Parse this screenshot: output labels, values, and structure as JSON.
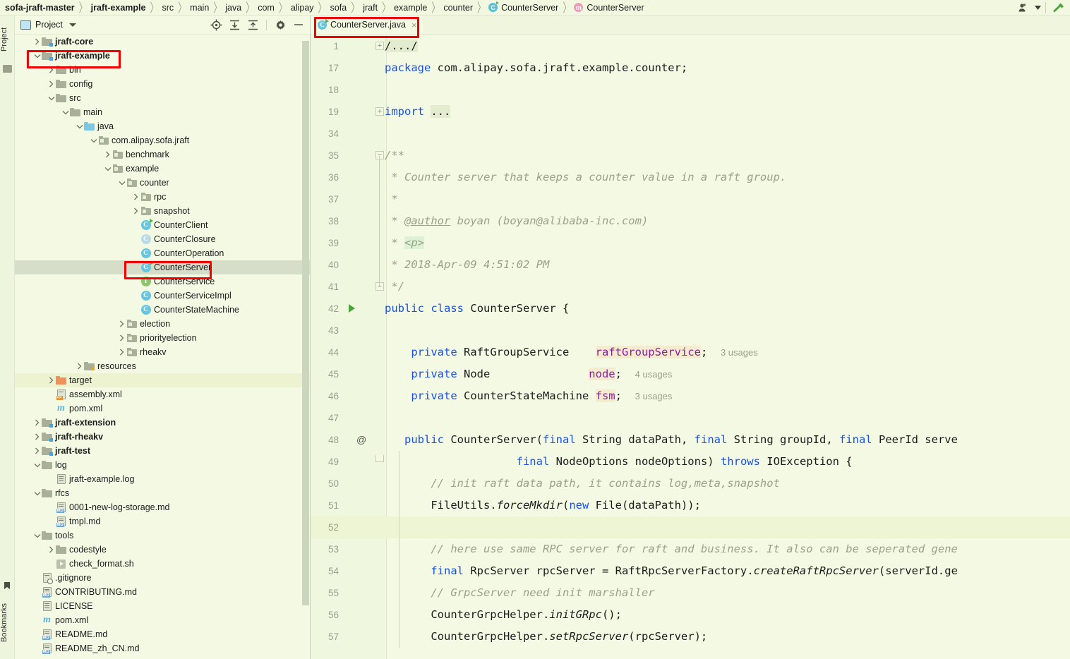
{
  "breadcrumb": {
    "items": [
      {
        "label": "sofa-jraft-master",
        "bold": true,
        "icon": null
      },
      {
        "label": "jraft-example",
        "bold": true,
        "icon": null
      },
      {
        "label": "src",
        "bold": false,
        "icon": null
      },
      {
        "label": "main",
        "bold": false,
        "icon": null
      },
      {
        "label": "java",
        "bold": false,
        "icon": null
      },
      {
        "label": "com",
        "bold": false,
        "icon": null
      },
      {
        "label": "alipay",
        "bold": false,
        "icon": null
      },
      {
        "label": "sofa",
        "bold": false,
        "icon": null
      },
      {
        "label": "jraft",
        "bold": false,
        "icon": null
      },
      {
        "label": "example",
        "bold": false,
        "icon": null
      },
      {
        "label": "counter",
        "bold": false,
        "icon": null
      },
      {
        "label": "CounterServer",
        "bold": false,
        "icon": "java-class-icon"
      },
      {
        "label": "CounterServer",
        "bold": false,
        "icon": "java-method-icon"
      }
    ],
    "separator": "〉"
  },
  "titlebar_right": {
    "account_icon": "user-account-icon",
    "account_dropdown": "chevron-down-icon",
    "build_icon": "build-hammer-icon"
  },
  "tool_strip": {
    "project_label": "Project",
    "bookmarks_label": "Bookmarks"
  },
  "project_panel": {
    "title": "Project",
    "window_icon": "project-window-icon",
    "dropdown_icon": "chevron-down-icon",
    "actions": [
      {
        "name": "select-opened-file-icon",
        "tooltip": "Select Opened File"
      },
      {
        "name": "expand-all-icon",
        "tooltip": "Expand All"
      },
      {
        "name": "collapse-all-icon",
        "tooltip": "Collapse All"
      },
      {
        "name": "settings-gear-icon",
        "tooltip": "Settings"
      },
      {
        "name": "hide-minimize-icon",
        "tooltip": "Hide"
      }
    ],
    "tree": [
      {
        "label": "jraft-core",
        "indent": 1,
        "arrow": "right",
        "icon": "module-folder",
        "bold": true
      },
      {
        "label": "jraft-example",
        "indent": 1,
        "arrow": "down",
        "icon": "module-folder",
        "bold": true
      },
      {
        "label": "bin",
        "indent": 2,
        "arrow": "right",
        "icon": "folder"
      },
      {
        "label": "config",
        "indent": 2,
        "arrow": "right",
        "icon": "folder"
      },
      {
        "label": "src",
        "indent": 2,
        "arrow": "down",
        "icon": "folder"
      },
      {
        "label": "main",
        "indent": 3,
        "arrow": "down",
        "icon": "folder"
      },
      {
        "label": "java",
        "indent": 4,
        "arrow": "down",
        "icon": "source-folder"
      },
      {
        "label": "com.alipay.sofa.jraft",
        "indent": 5,
        "arrow": "down",
        "icon": "package"
      },
      {
        "label": "benchmark",
        "indent": 6,
        "arrow": "right",
        "icon": "package"
      },
      {
        "label": "example",
        "indent": 6,
        "arrow": "down",
        "icon": "package"
      },
      {
        "label": "counter",
        "indent": 7,
        "arrow": "down",
        "icon": "package"
      },
      {
        "label": "rpc",
        "indent": 8,
        "arrow": "right",
        "icon": "package"
      },
      {
        "label": "snapshot",
        "indent": 8,
        "arrow": "right",
        "icon": "package"
      },
      {
        "label": "CounterClient",
        "indent": 8,
        "arrow": "none",
        "icon": "java-class-runnable"
      },
      {
        "label": "CounterClosure",
        "indent": 8,
        "arrow": "none",
        "icon": "java-class-abstract"
      },
      {
        "label": "CounterOperation",
        "indent": 8,
        "arrow": "none",
        "icon": "java-class"
      },
      {
        "label": "CounterServer",
        "indent": 8,
        "arrow": "none",
        "icon": "java-class-runnable",
        "selected": true
      },
      {
        "label": "CounterService",
        "indent": 8,
        "arrow": "none",
        "icon": "java-interface"
      },
      {
        "label": "CounterServiceImpl",
        "indent": 8,
        "arrow": "none",
        "icon": "java-class"
      },
      {
        "label": "CounterStateMachine",
        "indent": 8,
        "arrow": "none",
        "icon": "java-class"
      },
      {
        "label": "election",
        "indent": 7,
        "arrow": "right",
        "icon": "package"
      },
      {
        "label": "priorityelection",
        "indent": 7,
        "arrow": "right",
        "icon": "package"
      },
      {
        "label": "rheakv",
        "indent": 7,
        "arrow": "right",
        "icon": "package"
      },
      {
        "label": "resources",
        "indent": 4,
        "arrow": "right",
        "icon": "resources-folder"
      },
      {
        "label": "target",
        "indent": 2,
        "arrow": "right",
        "icon": "excluded-folder",
        "highlight": true
      },
      {
        "label": "assembly.xml",
        "indent": 2,
        "arrow": "none",
        "icon": "xml-file"
      },
      {
        "label": "pom.xml",
        "indent": 2,
        "arrow": "none",
        "icon": "maven-file"
      },
      {
        "label": "jraft-extension",
        "indent": 1,
        "arrow": "right",
        "icon": "module-folder",
        "bold": true
      },
      {
        "label": "jraft-rheakv",
        "indent": 1,
        "arrow": "right",
        "icon": "module-folder",
        "bold": true
      },
      {
        "label": "jraft-test",
        "indent": 1,
        "arrow": "right",
        "icon": "module-folder",
        "bold": true
      },
      {
        "label": "log",
        "indent": 1,
        "arrow": "down",
        "icon": "folder"
      },
      {
        "label": "jraft-example.log",
        "indent": 2,
        "arrow": "none",
        "icon": "text-file"
      },
      {
        "label": "rfcs",
        "indent": 1,
        "arrow": "down",
        "icon": "folder"
      },
      {
        "label": "0001-new-log-storage.md",
        "indent": 2,
        "arrow": "none",
        "icon": "markdown-file"
      },
      {
        "label": "tmpl.md",
        "indent": 2,
        "arrow": "none",
        "icon": "markdown-file"
      },
      {
        "label": "tools",
        "indent": 1,
        "arrow": "down",
        "icon": "folder"
      },
      {
        "label": "codestyle",
        "indent": 2,
        "arrow": "right",
        "icon": "folder"
      },
      {
        "label": "check_format.sh",
        "indent": 2,
        "arrow": "none",
        "icon": "shell-file"
      },
      {
        "label": ".gitignore",
        "indent": 1,
        "arrow": "none",
        "icon": "gitignore-file"
      },
      {
        "label": "CONTRIBUTING.md",
        "indent": 1,
        "arrow": "none",
        "icon": "markdown-file"
      },
      {
        "label": "LICENSE",
        "indent": 1,
        "arrow": "none",
        "icon": "text-file"
      },
      {
        "label": "pom.xml",
        "indent": 1,
        "arrow": "none",
        "icon": "maven-file"
      },
      {
        "label": "README.md",
        "indent": 1,
        "arrow": "none",
        "icon": "markdown-file"
      },
      {
        "label": "README_zh_CN.md",
        "indent": 1,
        "arrow": "none",
        "icon": "markdown-file"
      }
    ]
  },
  "editor": {
    "tabs": [
      {
        "label": "CounterServer.java",
        "icon": "java-class-runnable",
        "close": "×",
        "active": true
      }
    ],
    "line_numbers": [
      "1",
      "17",
      "18",
      "19",
      "34",
      "35",
      "36",
      "37",
      "38",
      "39",
      "40",
      "41",
      "42",
      "43",
      "44",
      "45",
      "46",
      "47",
      "48",
      "49",
      "50",
      "51",
      "52",
      "53",
      "54",
      "55",
      "56",
      "57"
    ],
    "current_line": "52",
    "inlay_hints": [
      "3 usages",
      "4 usages",
      "3 usages"
    ],
    "gutter_marks": {
      "run_line": "42",
      "at_line": "48"
    },
    "folded_regions": [
      "/.../",
      "import ..."
    ]
  },
  "annotations": {
    "color": "#f00000",
    "boxes": [
      "jraft-example-tree-node",
      "CounterServer-tree-node",
      "CounterServer.java-tab"
    ]
  },
  "colors": {
    "background": "#f3f9e2",
    "selection": "#d6ddc9",
    "keyword": "#1750eb",
    "field": "#8a1f9e",
    "comment": "#9aa18c",
    "string_paren": "#0a7b28",
    "annotation_red": "#f00000"
  }
}
